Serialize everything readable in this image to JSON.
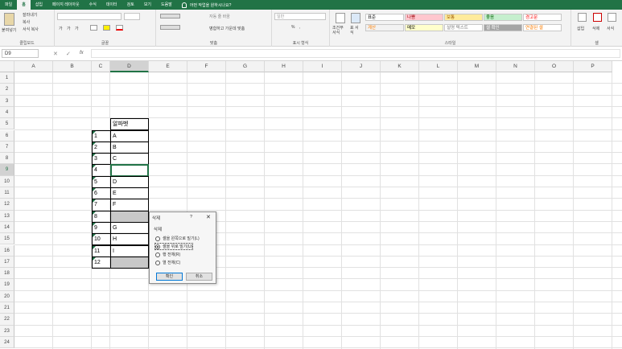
{
  "menu": {
    "tabs": [
      "파일",
      "홈",
      "삽입",
      "페이지 레이아웃",
      "수식",
      "데이터",
      "검토",
      "보기",
      "도움말"
    ],
    "tell_me": "어떤 작업을 원하시나요?"
  },
  "ribbon": {
    "clipboard": {
      "label": "클립보드",
      "paste": "붙여넣기",
      "cut": "잘라내기",
      "copy": "복사",
      "format_painter": "서식 복사"
    },
    "font": {
      "label": "글꼴",
      "bold": "가",
      "italic": "가",
      "underline": "가"
    },
    "alignment": {
      "label": "맞춤",
      "wrap_text": "자동 줄 바꿈",
      "merge_center": "병합하고 가운데 맞춤"
    },
    "number": {
      "label": "표시 형식",
      "format": "일반",
      "percent": "%",
      "comma": ","
    },
    "styles": {
      "label": "스타일",
      "conditional": "조건부 서식",
      "table_format": "표 서식",
      "items": [
        {
          "label": "표준",
          "bg": "#ffffff",
          "fg": "#000000"
        },
        {
          "label": "나쁨",
          "bg": "#ffc7ce",
          "fg": "#9c0006"
        },
        {
          "label": "보통",
          "bg": "#ffeb9c",
          "fg": "#9c5700"
        },
        {
          "label": "좋음",
          "bg": "#c6efce",
          "fg": "#006100"
        },
        {
          "label": "경고문",
          "bg": "#ffffff",
          "fg": "#ff0000"
        },
        {
          "label": "계산",
          "bg": "#f2f2f2",
          "fg": "#fa7d00"
        },
        {
          "label": "메모",
          "bg": "#ffffcc",
          "fg": "#000000"
        },
        {
          "label": "설명 텍스트",
          "bg": "#ffffff",
          "fg": "#7f7f7f"
        },
        {
          "label": "셀 확인",
          "bg": "#a5a5a5",
          "fg": "#ffffff"
        },
        {
          "label": "연결된 셀",
          "bg": "#ffffff",
          "fg": "#fa7d00"
        }
      ]
    },
    "cells": {
      "label": "셀",
      "insert": "삽입",
      "delete": "삭제",
      "format": "서식"
    }
  },
  "formula_bar": {
    "name_box": "D9",
    "fx": "fx"
  },
  "grid": {
    "columns": [
      "A",
      "B",
      "C",
      "D",
      "E",
      "F",
      "G",
      "H",
      "I",
      "J",
      "K",
      "L",
      "M",
      "N",
      "O",
      "P"
    ],
    "rows": [
      "1",
      "2",
      "3",
      "4",
      "5",
      "6",
      "7",
      "8",
      "9",
      "10",
      "11",
      "12",
      "13",
      "14",
      "15",
      "16",
      "17",
      "18",
      "19",
      "20",
      "21",
      "22",
      "23",
      "24"
    ],
    "header_cell": "알파벳",
    "table": [
      [
        "1",
        "A"
      ],
      [
        "2",
        "B"
      ],
      [
        "3",
        "C"
      ],
      [
        "4",
        ""
      ],
      [
        "5",
        "D"
      ],
      [
        "6",
        "E"
      ],
      [
        "7",
        "F"
      ],
      [
        "8",
        ""
      ],
      [
        "9",
        "G"
      ],
      [
        "10",
        "H"
      ],
      [
        "11",
        "I"
      ],
      [
        "12",
        ""
      ]
    ]
  },
  "dialog": {
    "title": "삭제",
    "help": "?",
    "close": "✕",
    "section": "삭제",
    "options": [
      {
        "label": "셀을 왼쪽으로 밀기(L)",
        "checked": false
      },
      {
        "label": "셀을 위로 밀기(U)",
        "checked": true
      },
      {
        "label": "행 전체(R)",
        "checked": false
      },
      {
        "label": "열 전체(C)",
        "checked": false
      }
    ],
    "ok": "확인",
    "cancel": "취소"
  }
}
